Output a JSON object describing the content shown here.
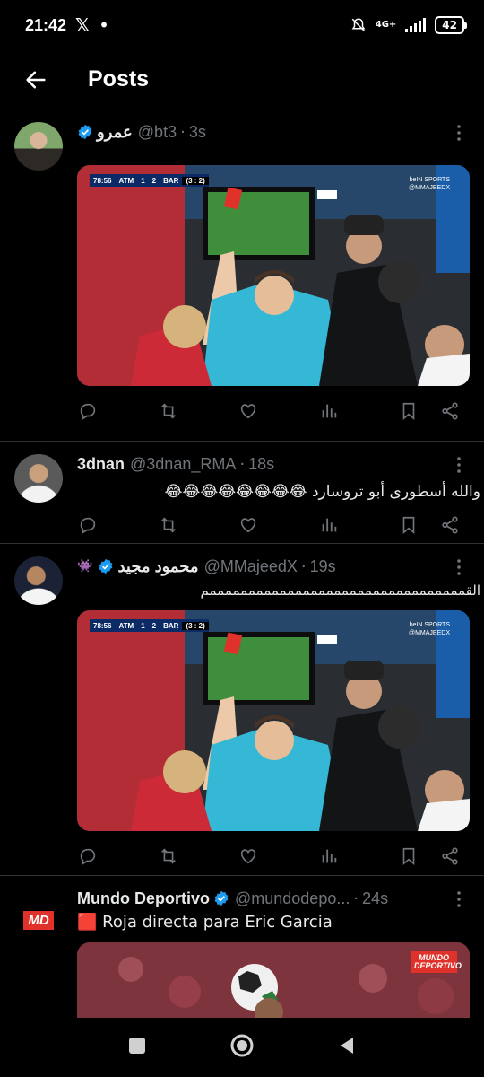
{
  "status_bar": {
    "time": "21:42",
    "network": "4G+",
    "battery": "42"
  },
  "header": {
    "title": "Posts"
  },
  "posts": [
    {
      "name": "عمرو",
      "handle": "@bt3",
      "time": "3s",
      "verified": true,
      "text": "",
      "media": {
        "scoreboard": {
          "clock": "78:56",
          "home": "ATM",
          "home_score": "1",
          "away_score": "2",
          "away": "BAR",
          "aggregate": "(3 : 2)"
        },
        "channel": "beIN SPORTS",
        "watermark": "@MMAJEEDX"
      }
    },
    {
      "name": "3dnan",
      "handle": "@3dnan_RMA",
      "time": "18s",
      "verified": false,
      "text": "والله أسطورى أبو تروسارد 😂😂😂😂😂😂😂😂"
    },
    {
      "name": "محمود مجيد",
      "handle": "@MMajeedX",
      "time": "19s",
      "verified": true,
      "text": "القمممممممممممممممممممممممممممممممممم",
      "media": {
        "scoreboard": {
          "clock": "78:56",
          "home": "ATM",
          "home_score": "1",
          "away_score": "2",
          "away": "BAR",
          "aggregate": "(3 : 2)"
        },
        "channel": "beIN SPORTS",
        "watermark": "@MMAJEEDX"
      }
    },
    {
      "name": "Mundo Deportivo",
      "handle": "@mundodepo...",
      "time": "24s",
      "verified": true,
      "text": "🟥 Roja directa para Eric Garcia",
      "avatar_text": "MD",
      "media_logo": "MUNDO DEPORTIVO"
    }
  ],
  "colors": {
    "background": "#000000",
    "divider": "#2f3336",
    "secondary_text": "#71767b",
    "verified": "#1d9bf0",
    "red_card": "#e0322b"
  },
  "icons": [
    "back-arrow-icon",
    "verified-badge-icon",
    "more-options-icon",
    "reply-icon",
    "repost-icon",
    "like-icon",
    "views-icon",
    "bookmark-icon",
    "share-icon",
    "nav-recents-icon",
    "nav-home-icon",
    "nav-back-icon"
  ]
}
